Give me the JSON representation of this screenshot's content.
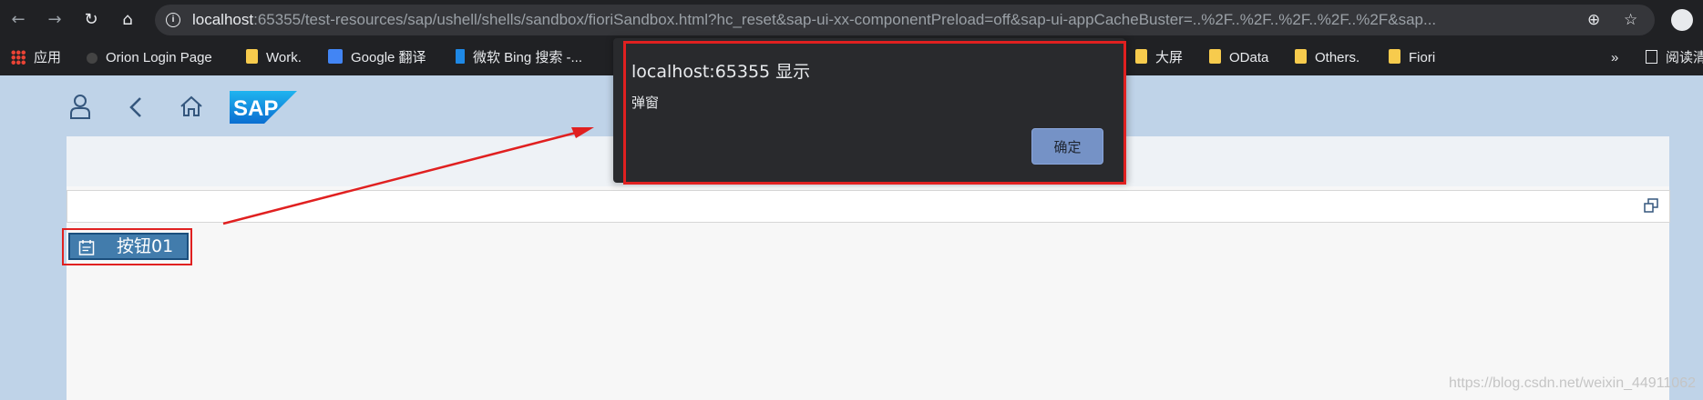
{
  "browser": {
    "url_host": "localhost",
    "url_rest": ":65355/test-resources/sap/ushell/shells/sandbox/fioriSandbox.html?hc_reset&sap-ui-xx-componentPreload=off&sap-ui-appCacheBuster=..%2F..%2F..%2F..%2F..%2F&sap...",
    "bookmarks": [
      {
        "label": "应用",
        "icon": "apps-grid-icon"
      },
      {
        "label": "Orion Login Page",
        "icon": "orion-icon"
      },
      {
        "label": "Work.",
        "icon": "folder-icon"
      },
      {
        "label": "Google 翻译",
        "icon": "google-translate-icon"
      },
      {
        "label": "微软 Bing 搜索 -...",
        "icon": "bing-icon"
      },
      {
        "label": "大屏",
        "icon": "folder-icon"
      },
      {
        "label": "OData",
        "icon": "folder-icon"
      },
      {
        "label": "Others.",
        "icon": "folder-icon"
      },
      {
        "label": "Fiori",
        "icon": "folder-icon"
      }
    ],
    "overflow": "»",
    "reading_list": "阅读清"
  },
  "shell": {
    "logo_text": "SAP",
    "icons": [
      "user-icon",
      "back-icon",
      "home-icon"
    ]
  },
  "content": {
    "button_label": "按钮01",
    "button_icon": "calendar-icon"
  },
  "alert": {
    "title": "localhost:65355 显示",
    "message": "弹窗",
    "ok_label": "确定"
  },
  "watermark": "https://blog.csdn.net/weixin_44911062",
  "colors": {
    "highlight": "#e02020",
    "shell_background": "#bfd3e8",
    "button": "#427cac"
  }
}
